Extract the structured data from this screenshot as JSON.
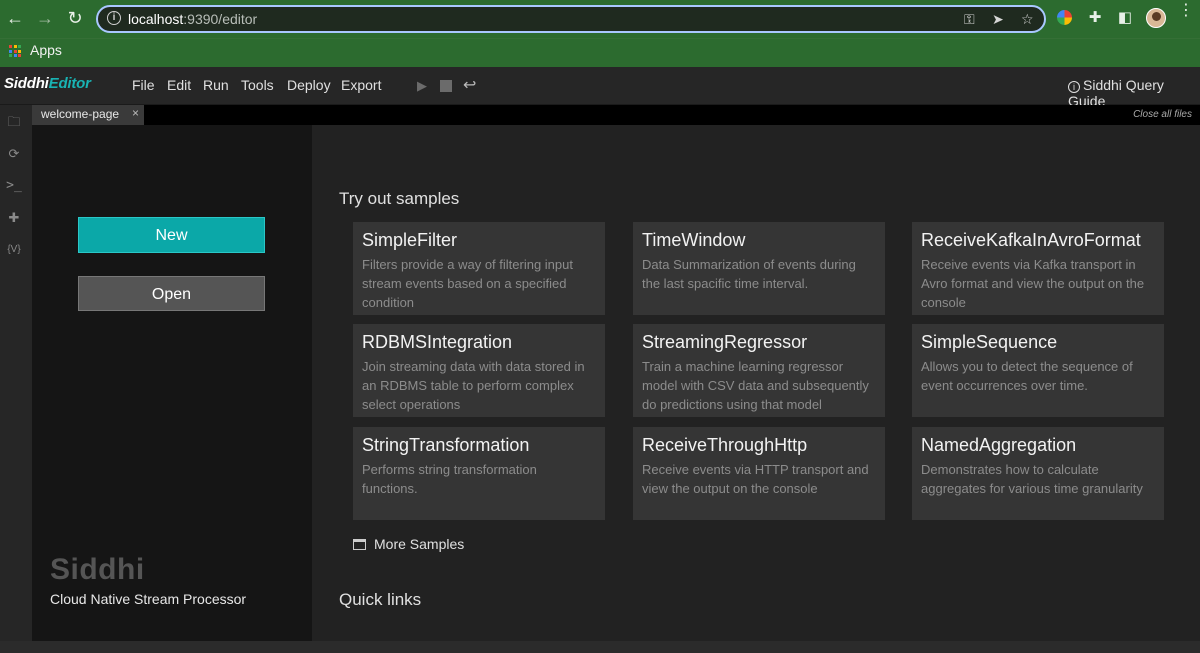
{
  "browser": {
    "url_host": "localhost",
    "url_path": ":9390/editor",
    "bookmarks_label": "Apps"
  },
  "app": {
    "logo_prefix": "Siddhi",
    "logo_suffix": "Editor",
    "menu": [
      "File",
      "Edit",
      "Run",
      "Tools",
      "Deploy",
      "Export"
    ],
    "guide_label": "Siddhi Query Guide"
  },
  "tabs": {
    "active_label": "welcome-page",
    "close_glyph": "×",
    "close_all_label": "Close all files"
  },
  "welcome": {
    "new_label": "New",
    "open_label": "Open",
    "brand": "Siddhi",
    "tagline": "Cloud Native Stream Processor",
    "samples_title": "Try out samples",
    "more_samples_label": "More Samples",
    "quick_links_title": "Quick links",
    "samples": [
      {
        "title": "SimpleFilter",
        "desc": "Filters provide a way of filtering input stream events based on a specified condition"
      },
      {
        "title": "TimeWindow",
        "desc": "Data Summarization of events during the last spacific time interval."
      },
      {
        "title": "ReceiveKafkaInAvroFormat",
        "desc": "Receive events via Kafka transport in Avro format and view the output on the console"
      },
      {
        "title": "RDBMSIntegration",
        "desc": "Join streaming data with data stored in an RDBMS table to perform complex select operations"
      },
      {
        "title": "StreamingRegressor",
        "desc": "Train a machine learning regressor model with CSV data and subsequently do predictions using that model"
      },
      {
        "title": "SimpleSequence",
        "desc": "Allows you to detect the sequence of event occurrences over time."
      },
      {
        "title": "StringTransformation",
        "desc": "Performs string transformation functions."
      },
      {
        "title": "ReceiveThroughHttp",
        "desc": "Receive events via HTTP transport and view the output on the console"
      },
      {
        "title": "NamedAggregation",
        "desc": "Demonstrates how to calculate aggregates for various time granularity"
      }
    ]
  },
  "colors": {
    "chrome_green": "#2c6b2f",
    "accent_teal": "#0ba8a8",
    "card_bg": "#353535"
  },
  "icons": {
    "side": [
      "folder-icon",
      "deploy-icon",
      "terminal-icon",
      "extension-icon",
      "variables-icon"
    ]
  }
}
